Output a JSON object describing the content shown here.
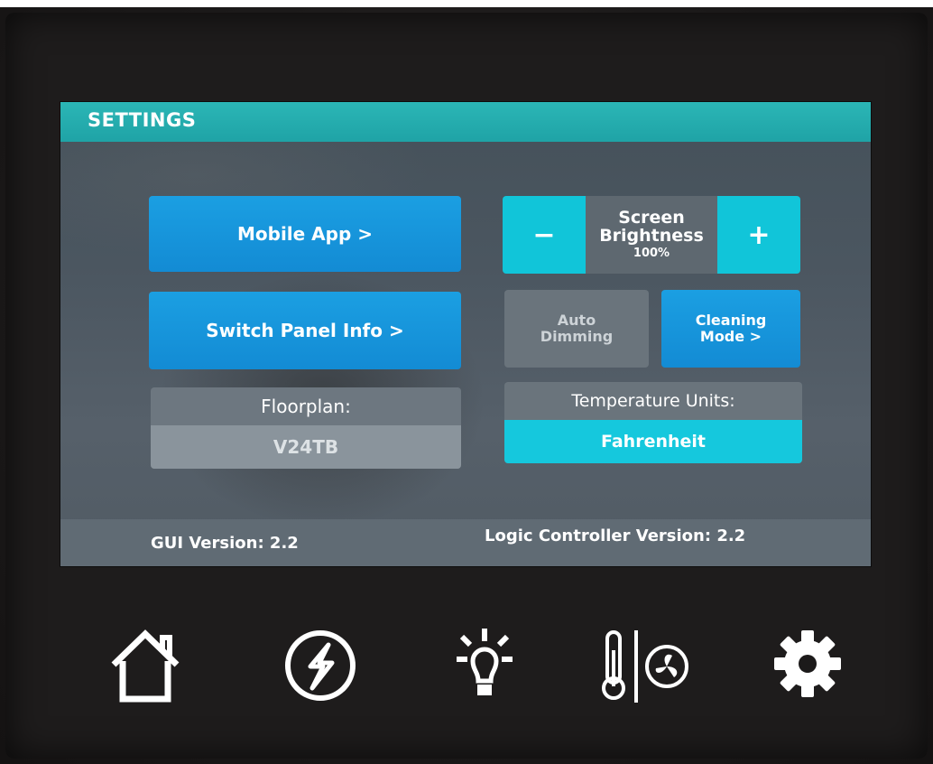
{
  "header": {
    "title": "SETTINGS"
  },
  "buttons": {
    "mobile_app": "Mobile App >",
    "switch_panel_info": "Switch Panel Info >",
    "auto_dimming_line1": "Auto",
    "auto_dimming_line2": "Dimming",
    "cleaning_mode_line1": "Cleaning",
    "cleaning_mode_line2": "Mode >"
  },
  "brightness": {
    "minus": "−",
    "plus": "+",
    "label_line1": "Screen",
    "label_line2": "Brightness",
    "value": "100%"
  },
  "floorplan": {
    "label": "Floorplan:",
    "value": "V24TB"
  },
  "temperature": {
    "label": "Temperature Units:",
    "value": "Fahrenheit"
  },
  "footer": {
    "gui_version": "GUI Version: 2.2",
    "logic_version": "Logic Controller Version: 2.2"
  },
  "nav": {
    "items": [
      "home-icon",
      "power-icon",
      "lighting-icon",
      "climate-icon",
      "settings-gear-icon"
    ],
    "active": "settings-gear-icon"
  },
  "colors": {
    "title_bar": "#1fa3a6",
    "button_blue": "#138bd4",
    "accent_cyan": "#15c8dd",
    "disabled_gray": "#6a747c"
  }
}
